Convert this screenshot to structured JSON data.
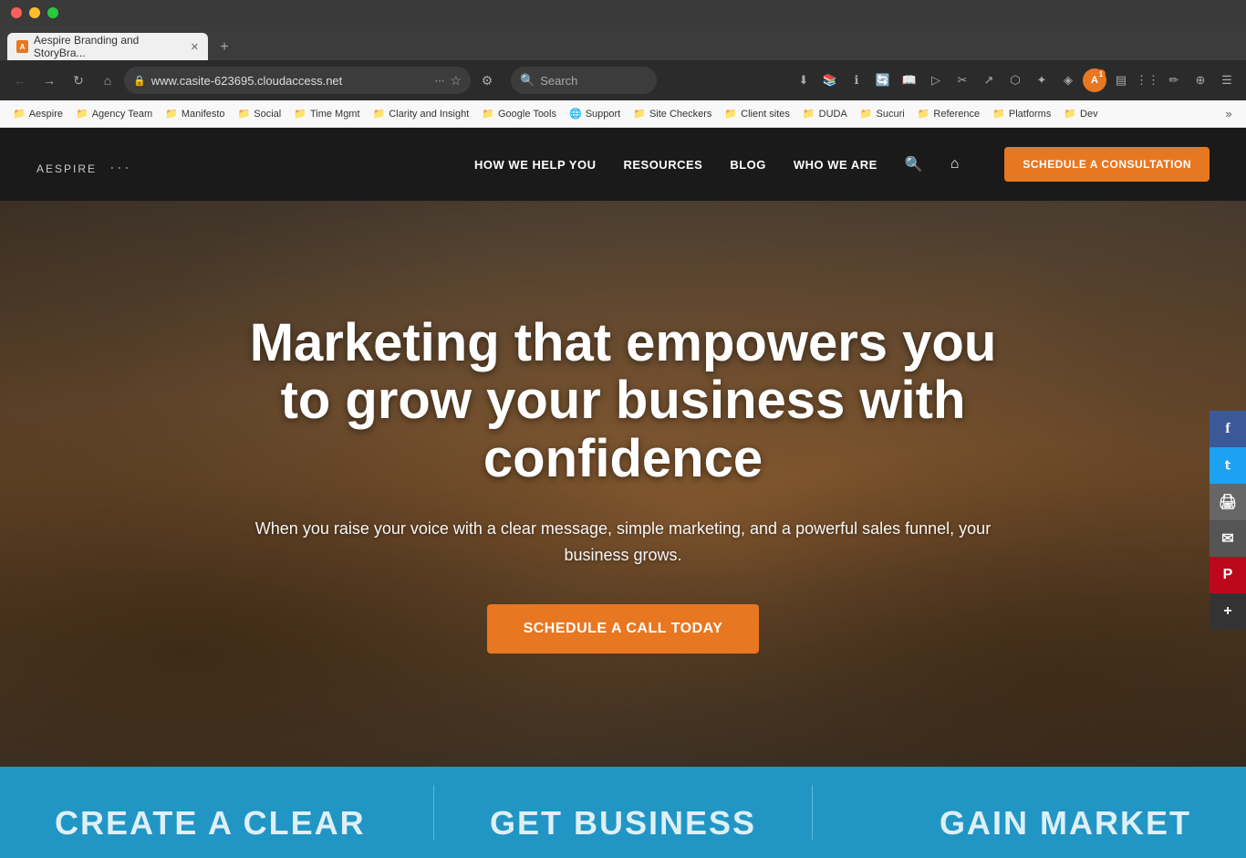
{
  "os": {
    "btn_red": "●",
    "btn_yellow": "●",
    "btn_green": "●"
  },
  "browser": {
    "tab_favicon": "A",
    "tab_title": "Aespire Branding and StoryBra...",
    "tab_close": "✕",
    "new_tab": "+",
    "back": "←",
    "forward": "→",
    "home": "⌂",
    "tools": "⚙",
    "reload": "↻",
    "address": "www.casite-623695.cloudaccess.net",
    "search_placeholder": "Search",
    "toolbar_more": "⋯",
    "bookmark_star": "☆",
    "bookmark_extension": "★",
    "extension_bar": "»"
  },
  "bookmarks": {
    "items": [
      {
        "label": "Aespire",
        "icon": "📁"
      },
      {
        "label": "Agency Team",
        "icon": "📁"
      },
      {
        "label": "Manifesto",
        "icon": "📁"
      },
      {
        "label": "Social",
        "icon": "📁"
      },
      {
        "label": "Time Mgmt",
        "icon": "📁"
      },
      {
        "label": "Clarity and Insight",
        "icon": "📁"
      },
      {
        "label": "Google Tools",
        "icon": "📁"
      },
      {
        "label": "Support",
        "icon": "🌐"
      },
      {
        "label": "Site Checkers",
        "icon": "📁"
      },
      {
        "label": "Client sites",
        "icon": "📁"
      },
      {
        "label": "DUDA",
        "icon": "📁"
      },
      {
        "label": "Sucuri",
        "icon": "📁"
      },
      {
        "label": "Reference",
        "icon": "📁"
      },
      {
        "label": "Platforms",
        "icon": "📁"
      },
      {
        "label": "Dev",
        "icon": "📁"
      }
    ],
    "more": "»"
  },
  "site": {
    "logo_text": "AESPIRE",
    "logo_sub": "···",
    "nav": {
      "how_we_help": "HOW WE HELP YOU",
      "resources": "RESOURCES",
      "blog": "BLOG",
      "who_we_are": "WHO WE ARE",
      "cta": "SCHEDULE A CONSULTATION"
    },
    "hero": {
      "headline": "Marketing that empowers you to grow your business with confidence",
      "subtext": "When you raise your voice with a clear message, simple marketing, and a powerful sales funnel, your business grows.",
      "cta": "Schedule a Call Today"
    },
    "social": {
      "facebook": "f",
      "twitter": "t",
      "print": "🖨",
      "email": "✉",
      "pinterest": "P",
      "more": "+"
    },
    "bottom": {
      "col1": "CREATE A CLEAR",
      "col2": "GET BUSINESS",
      "col3": "GAIN MARKET"
    }
  }
}
